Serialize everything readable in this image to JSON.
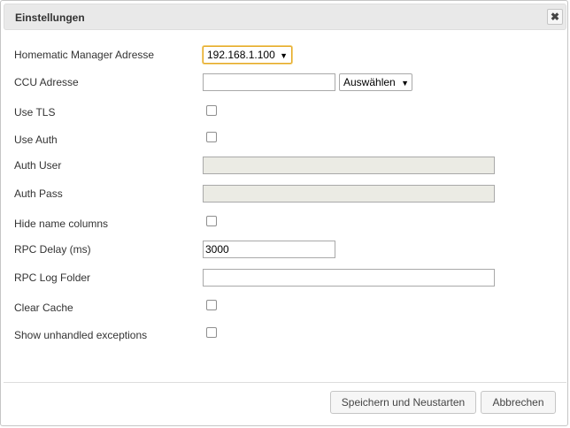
{
  "dialog": {
    "title": "Einstellungen",
    "close_icon": "close-icon"
  },
  "fields": {
    "manager_address": {
      "label": "Homematic Manager Adresse",
      "value": "192.168.1.100"
    },
    "ccu_address": {
      "label": "CCU Adresse",
      "value": "",
      "select_label": "Auswählen"
    },
    "use_tls": {
      "label": "Use TLS",
      "checked": false
    },
    "use_auth": {
      "label": "Use Auth",
      "checked": false
    },
    "auth_user": {
      "label": "Auth User",
      "value": ""
    },
    "auth_pass": {
      "label": "Auth Pass",
      "value": ""
    },
    "hide_name_columns": {
      "label": "Hide name columns",
      "checked": false
    },
    "rpc_delay": {
      "label": "RPC Delay (ms)",
      "value": "3000"
    },
    "rpc_log_folder": {
      "label": "RPC Log Folder",
      "value": ""
    },
    "clear_cache": {
      "label": "Clear Cache",
      "checked": false
    },
    "show_unhandled_exceptions": {
      "label": "Show unhandled exceptions",
      "checked": false
    }
  },
  "footer": {
    "save_label": "Speichern und Neustarten",
    "cancel_label": "Abbrechen"
  },
  "dropdown_arrow": "▼",
  "colors": {
    "titlebar_bg": "#e9e9e9",
    "focus_border": "#e5a823",
    "disabled_input_bg": "#ebebe4"
  }
}
